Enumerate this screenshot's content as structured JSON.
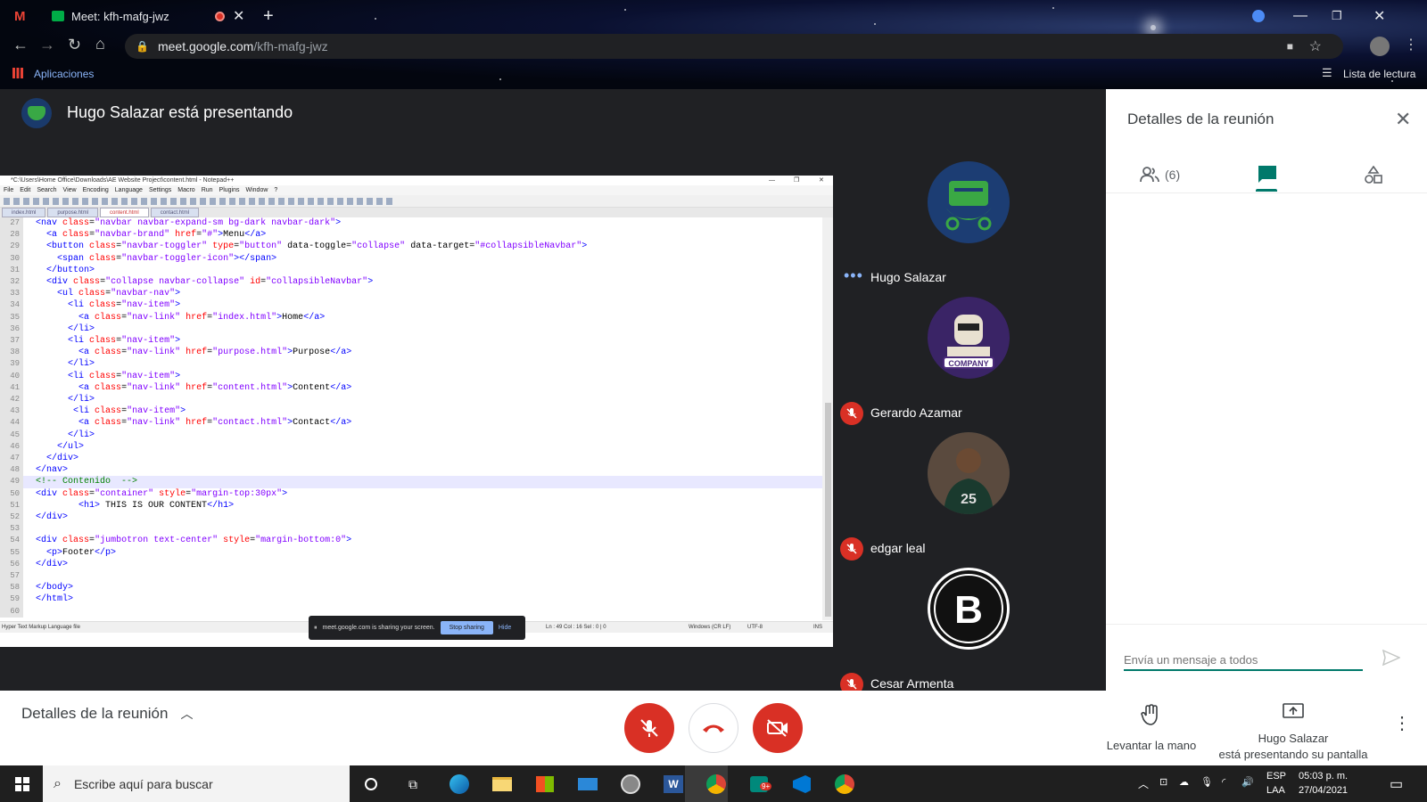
{
  "browser": {
    "tab_title": "Meet: kfh-mafg-jwz",
    "url_domain": "meet.google.com",
    "url_path": "/kfh-mafg-jwz",
    "bookmark_apps": "Aplicaciones",
    "reading_list": "Lista de lectura"
  },
  "meet": {
    "presenting_title": "Hugo Salazar está presentando",
    "participants": [
      {
        "name": "Hugo Salazar",
        "muted": false,
        "avatar": "logo-green-face"
      },
      {
        "name": "Gerardo Azamar",
        "muted": true,
        "avatar": "company-logo"
      },
      {
        "name": "edgar leal",
        "muted": true,
        "avatar": "basketball-player-25"
      },
      {
        "name": "Cesar Armenta",
        "muted": true,
        "avatar": "nets-b-logo"
      }
    ]
  },
  "notepad": {
    "title": "*C:\\Users\\Home Office\\Downloads\\AE Website Project\\content.html - Notepad++",
    "menu": [
      "File",
      "Edit",
      "Search",
      "View",
      "Encoding",
      "Language",
      "Settings",
      "Macro",
      "Run",
      "Plugins",
      "Window",
      "?"
    ],
    "tabs": [
      "index.html",
      "purpose.html",
      "content.html",
      "contact.html"
    ],
    "active_tab": "content.html",
    "status_left": "Hyper Text Markup Language file",
    "status_pos": "Ln : 49    Col : 16    Sel : 0 | 0",
    "status_eol": "Windows (CR LF)",
    "status_enc": "UTF-8",
    "status_ins": "INS",
    "lines": [
      {
        "n": "27",
        "html": "<span class=\"tag\">&lt;nav</span> <span class=\"attr\">class</span>=<span class=\"val\">\"navbar navbar-expand-sm bg-dark navbar-dark\"</span><span class=\"tag\">&gt;</span>"
      },
      {
        "n": "28",
        "html": "  <span class=\"tag\">&lt;a</span> <span class=\"attr\">class</span>=<span class=\"val\">\"navbar-brand\"</span> <span class=\"attr\">href</span>=<span class=\"val\">\"#\"</span><span class=\"tag\">&gt;</span>Menu<span class=\"tag\">&lt;/a&gt;</span>"
      },
      {
        "n": "29",
        "html": "  <span class=\"tag\">&lt;button</span> <span class=\"attr\">class</span>=<span class=\"val\">\"navbar-toggler\"</span> <span class=\"attr\">type</span>=<span class=\"val\">\"button\"</span> data-toggle=<span class=\"val\">\"collapse\"</span> data-target=<span class=\"val\">\"#collapsibleNavbar\"</span><span class=\"tag\">&gt;</span>"
      },
      {
        "n": "30",
        "html": "    <span class=\"tag\">&lt;span</span> <span class=\"attr\">class</span>=<span class=\"val\">\"navbar-toggler-icon\"</span><span class=\"tag\">&gt;&lt;/span&gt;</span>"
      },
      {
        "n": "31",
        "html": "  <span class=\"tag\">&lt;/button&gt;</span>"
      },
      {
        "n": "32",
        "html": "  <span class=\"tag\">&lt;div</span> <span class=\"attr\">class</span>=<span class=\"val\">\"collapse navbar-collapse\"</span> <span class=\"attr\">id</span>=<span class=\"val\">\"collapsibleNavbar\"</span><span class=\"tag\">&gt;</span>"
      },
      {
        "n": "33",
        "html": "    <span class=\"tag\">&lt;ul</span> <span class=\"attr\">class</span>=<span class=\"val\">\"navbar-nav\"</span><span class=\"tag\">&gt;</span>"
      },
      {
        "n": "34",
        "html": "      <span class=\"tag\">&lt;li</span> <span class=\"attr\">class</span>=<span class=\"val\">\"nav-item\"</span><span class=\"tag\">&gt;</span>"
      },
      {
        "n": "35",
        "html": "        <span class=\"tag\">&lt;a</span> <span class=\"attr\">class</span>=<span class=\"val\">\"nav-link\"</span> <span class=\"attr\">href</span>=<span class=\"val\">\"index.html\"</span><span class=\"tag\">&gt;</span>Home<span class=\"tag\">&lt;/a&gt;</span>"
      },
      {
        "n": "36",
        "html": "      <span class=\"tag\">&lt;/li&gt;</span>"
      },
      {
        "n": "37",
        "html": "      <span class=\"tag\">&lt;li</span> <span class=\"attr\">class</span>=<span class=\"val\">\"nav-item\"</span><span class=\"tag\">&gt;</span>"
      },
      {
        "n": "38",
        "html": "        <span class=\"tag\">&lt;a</span> <span class=\"attr\">class</span>=<span class=\"val\">\"nav-link\"</span> <span class=\"attr\">href</span>=<span class=\"val\">\"purpose.html\"</span><span class=\"tag\">&gt;</span>Purpose<span class=\"tag\">&lt;/a&gt;</span>"
      },
      {
        "n": "39",
        "html": "      <span class=\"tag\">&lt;/li&gt;</span>"
      },
      {
        "n": "40",
        "html": "      <span class=\"tag\">&lt;li</span> <span class=\"attr\">class</span>=<span class=\"val\">\"nav-item\"</span><span class=\"tag\">&gt;</span>"
      },
      {
        "n": "41",
        "html": "        <span class=\"tag\">&lt;a</span> <span class=\"attr\">class</span>=<span class=\"val\">\"nav-link\"</span> <span class=\"attr\">href</span>=<span class=\"val\">\"content.html\"</span><span class=\"tag\">&gt;</span>Content<span class=\"tag\">&lt;/a&gt;</span>"
      },
      {
        "n": "42",
        "html": "      <span class=\"tag\">&lt;/li&gt;</span>"
      },
      {
        "n": "43",
        "html": "       <span class=\"tag\">&lt;li</span> <span class=\"attr\">class</span>=<span class=\"val\">\"nav-item\"</span><span class=\"tag\">&gt;</span>"
      },
      {
        "n": "44",
        "html": "        <span class=\"tag\">&lt;a</span> <span class=\"attr\">class</span>=<span class=\"val\">\"nav-link\"</span> <span class=\"attr\">href</span>=<span class=\"val\">\"contact.html\"</span><span class=\"tag\">&gt;</span>Contact<span class=\"tag\">&lt;/a&gt;</span>"
      },
      {
        "n": "45",
        "html": "      <span class=\"tag\">&lt;/li&gt;</span>"
      },
      {
        "n": "46",
        "html": "    <span class=\"tag\">&lt;/ul&gt;</span>"
      },
      {
        "n": "47",
        "html": "  <span class=\"tag\">&lt;/div&gt;</span>"
      },
      {
        "n": "48",
        "html": "<span class=\"tag\">&lt;/nav&gt;</span>"
      },
      {
        "n": "49",
        "html": "<span class=\"cm\">&lt;!-- Contenido  --&gt;</span>",
        "hl": true
      },
      {
        "n": "50",
        "html": "<span class=\"tag\">&lt;div</span> <span class=\"attr\">class</span>=<span class=\"val\">\"container\"</span> <span class=\"attr\">style</span>=<span class=\"val\">\"margin-top:30px\"</span><span class=\"tag\">&gt;</span>"
      },
      {
        "n": "51",
        "html": "        <span class=\"tag\">&lt;h1&gt;</span> THIS IS OUR CONTENT<span class=\"tag\">&lt;/h1&gt;</span>"
      },
      {
        "n": "52",
        "html": "<span class=\"tag\">&lt;/div&gt;</span>"
      },
      {
        "n": "53",
        "html": ""
      },
      {
        "n": "54",
        "html": "<span class=\"tag\">&lt;div</span> <span class=\"attr\">class</span>=<span class=\"val\">\"jumbotron text-center\"</span> <span class=\"attr\">style</span>=<span class=\"val\">\"margin-bottom:0\"</span><span class=\"tag\">&gt;</span>"
      },
      {
        "n": "55",
        "html": "  <span class=\"tag\">&lt;p&gt;</span>Footer<span class=\"tag\">&lt;/p&gt;</span>"
      },
      {
        "n": "56",
        "html": "<span class=\"tag\">&lt;/div&gt;</span>"
      },
      {
        "n": "57",
        "html": ""
      },
      {
        "n": "58",
        "html": "<span class=\"tag\">&lt;/body&gt;</span>"
      },
      {
        "n": "59",
        "html": "<span class=\"tag\">&lt;/html&gt;</span>"
      },
      {
        "n": "60",
        "html": ""
      }
    ]
  },
  "share_banner": {
    "text": "meet.google.com is sharing your screen.",
    "stop": "Stop sharing",
    "hide": "Hide"
  },
  "panel": {
    "title": "Detalles de la reunión",
    "people_count": "(6)",
    "input_placeholder": "Envía un mensaje a todos"
  },
  "bottombar": {
    "details": "Detalles de la reunión",
    "raise_hand": "Levantar la mano",
    "presenter_line1": "Hugo Salazar",
    "presenter_line2": "está presentando su pantalla"
  },
  "taskbar": {
    "search_placeholder": "Escribe aquí para buscar",
    "lang1": "ESP",
    "lang2": "LAA",
    "time": "05:03 p. m.",
    "date": "27/04/2021",
    "notif_count": "9+"
  },
  "colors": {
    "accent_green": "#00796b",
    "danger_red": "#d93025",
    "meet_bg": "#202124"
  }
}
